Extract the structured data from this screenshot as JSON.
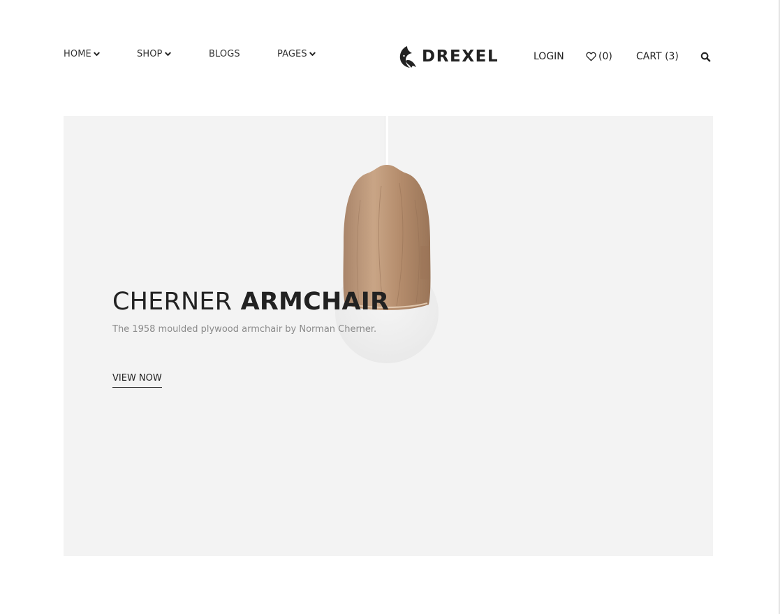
{
  "nav": {
    "items": [
      {
        "label": "HOME",
        "has_dropdown": true
      },
      {
        "label": "SHOP",
        "has_dropdown": true
      },
      {
        "label": "BLOGS",
        "has_dropdown": false
      },
      {
        "label": "PAGES",
        "has_dropdown": true
      }
    ]
  },
  "brand": {
    "name": "DREXEL",
    "icon": "bird-logo-icon"
  },
  "header_actions": {
    "login_label": "LOGIN",
    "wishlist_count": "(0)",
    "wishlist_icon": "heart-icon",
    "cart_label": "CART (3)",
    "search_icon": "search-icon"
  },
  "hero": {
    "title_light": "CHERNER",
    "title_bold": "ARMCHAIR",
    "subtitle": "The 1958 moulded plywood armchair by Norman Cherner.",
    "cta_label": "VIEW NOW",
    "image": "wooden-pendant-lamp"
  },
  "colors": {
    "text": "#222222",
    "muted": "#8a8a8a",
    "hero_bg": "#f3f3f3"
  }
}
